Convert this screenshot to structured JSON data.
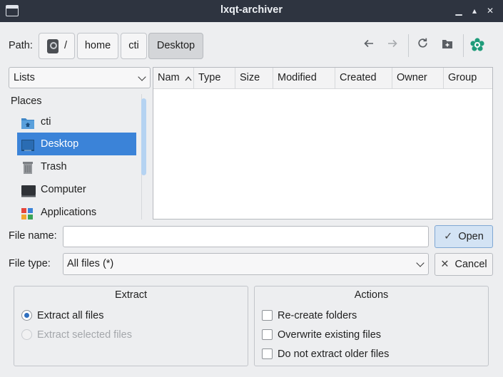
{
  "window": {
    "title": "lxqt-archiver",
    "controls": [
      "minimize-icon",
      "maximize-icon",
      "close-icon"
    ]
  },
  "path_bar": {
    "label": "Path:",
    "crumbs": [
      {
        "icon": "drive-icon",
        "label": "/"
      },
      {
        "label": "home"
      },
      {
        "label": "cti"
      },
      {
        "label": "Desktop",
        "active": true
      }
    ],
    "tools": [
      "back-arrow-icon",
      "forward-arrow-icon",
      "reload-icon",
      "new-folder-icon",
      "app-logo-icon"
    ]
  },
  "side_panel": {
    "view_selector": "Lists",
    "section_title": "Places",
    "items": [
      {
        "label": "cti",
        "icon": "home-folder-icon"
      },
      {
        "label": "Desktop",
        "icon": "desktop-icon",
        "selected": true
      },
      {
        "label": "Trash",
        "icon": "trash-icon"
      },
      {
        "label": "Computer",
        "icon": "computer-icon"
      },
      {
        "label": "Applications",
        "icon": "applications-icon"
      }
    ]
  },
  "file_table": {
    "columns": [
      "Nam",
      "Type",
      "Size",
      "Modified",
      "Created",
      "Owner",
      "Group"
    ],
    "sort_column": "Nam",
    "rows": []
  },
  "form": {
    "file_name_label": "File name:",
    "file_name_value": "",
    "file_type_label": "File type:",
    "file_type_value": "All files (*)",
    "open_label": "Open",
    "cancel_label": "Cancel"
  },
  "extract_group": {
    "title": "Extract",
    "options": [
      {
        "label": "Extract all files",
        "checked": true,
        "enabled": true
      },
      {
        "label": "Extract selected files",
        "checked": false,
        "enabled": false
      }
    ]
  },
  "actions_group": {
    "title": "Actions",
    "options": [
      {
        "label": "Re-create folders",
        "checked": false
      },
      {
        "label": "Overwrite existing files",
        "checked": false
      },
      {
        "label": "Do not extract older files",
        "checked": false
      }
    ]
  },
  "colors": {
    "titlebar": "#2e3440",
    "selection": "#3b83d8",
    "primary_button": "#d3e3f4"
  }
}
